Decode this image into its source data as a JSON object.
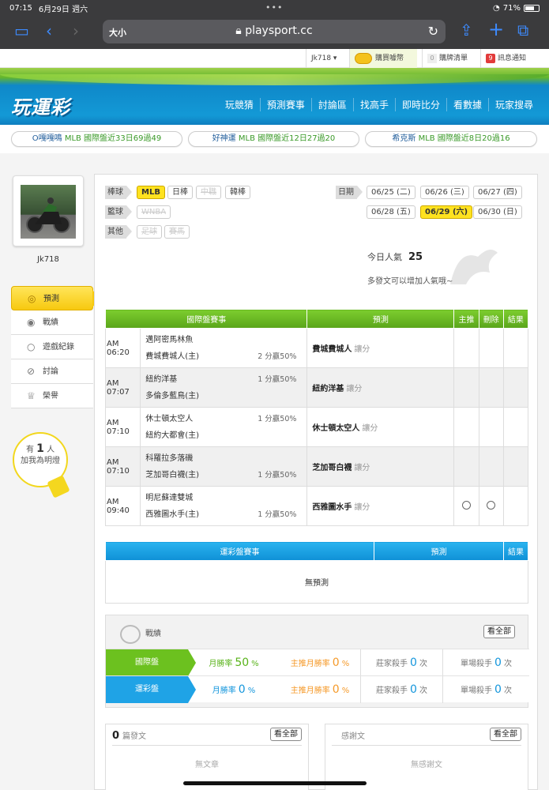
{
  "statusbar": {
    "time": "07:15",
    "date": "6月29日 週六",
    "battery": "71%"
  },
  "browser": {
    "text_size": "大小",
    "url": "playsport.cc"
  },
  "util": {
    "user": "Jk718 ▾",
    "buy": "購買噱幣",
    "cart_count": "0",
    "cart": "購牌清單",
    "notify_count": "9",
    "notify": "訊息通知"
  },
  "header": {
    "logo": "玩運彩",
    "nav": [
      "玩競猜",
      "預測賽事",
      "討論區",
      "找高手",
      "即時比分",
      "看數據",
      "玩家搜尋"
    ]
  },
  "tickers": [
    {
      "name": "O嘎嘎鳴",
      "text": "MLB 國際盤近33日69過49"
    },
    {
      "name": "好神運",
      "text": "MLB 國際盤近12日27過20"
    },
    {
      "name": "希克斯",
      "text": "MLB 國際盤近8日20過16"
    }
  ],
  "profile": {
    "username": "Jk718",
    "menu": [
      "預測",
      "戰績",
      "遊戲紀錄",
      "討論",
      "榮譽"
    ],
    "fans_prefix": "有",
    "fans_count": "1",
    "fans_unit": "人",
    "fans_suffix": "加我為明燈"
  },
  "filters": {
    "baseball_label": "棒球",
    "baseball": [
      "MLB",
      "日棒",
      "中職",
      "韓棒"
    ],
    "basketball_label": "籃球",
    "basketball": [
      "WNBA"
    ],
    "other_label": "其他",
    "other": [
      "足球",
      "賽馬"
    ],
    "date_label": "日期",
    "dates": [
      "06/25 (二)",
      "06/26 (三)",
      "06/27 (四)",
      "06/28 (五)",
      "06/29 (六)",
      "06/30 (日)"
    ]
  },
  "popularity": {
    "label": "今日人氣",
    "value": "25",
    "note": "多發文可以增加人氣哦~"
  },
  "intl_table": {
    "headers": [
      "國際盤賽事",
      "預測",
      "主推",
      "刪除",
      "結果"
    ],
    "rows": [
      {
        "time": "AM 06:20",
        "team1": "邁阿密馬林魚",
        "team2": "費城費城人(主)",
        "odds": "2 分贏50%",
        "odds_row": 2,
        "pick": "費城費城人",
        "type": "讓分",
        "circles": false
      },
      {
        "time": "AM 07:07",
        "team1": "紐約洋基",
        "team2": "多倫多藍鳥(主)",
        "odds": "1 分贏50%",
        "odds_row": 1,
        "pick": "紐約洋基",
        "type": "讓分",
        "circles": false
      },
      {
        "time": "AM 07:10",
        "team1": "休士頓太空人",
        "team2": "紐約大都會(主)",
        "odds": "1 分贏50%",
        "odds_row": 1,
        "pick": "休士頓太空人",
        "type": "讓分",
        "circles": false
      },
      {
        "time": "AM 07:10",
        "team1": "科羅拉多落磯",
        "team2": "芝加哥白襪(主)",
        "odds": "1 分贏50%",
        "odds_row": 2,
        "pick": "芝加哥白襪",
        "type": "讓分",
        "circles": false
      },
      {
        "time": "AM 09:40",
        "team1": "明尼蘇達雙城",
        "team2": "西雅圖水手(主)",
        "odds": "1 分贏50%",
        "odds_row": 2,
        "pick": "西雅圖水手",
        "type": "讓分",
        "circles": true
      }
    ]
  },
  "lottery_table": {
    "headers": [
      "運彩盤賽事",
      "預測",
      "結果"
    ],
    "empty": "無預測"
  },
  "record": {
    "title": "戰績",
    "view_all": "看全部",
    "rows": [
      {
        "label": "國際盤",
        "month_label": "月勝率",
        "month_value": "50",
        "top_label": "主推月勝率",
        "top_value": "0",
        "banker_label": "莊家殺手",
        "banker_value": "0",
        "single_label": "單場殺手",
        "single_value": "0"
      },
      {
        "label": "運彩盤",
        "month_label": "月勝率",
        "month_value": "0",
        "top_label": "主推月勝率",
        "top_value": "0",
        "banker_label": "莊家殺手",
        "banker_value": "0",
        "single_label": "單場殺手",
        "single_value": "0"
      }
    ],
    "pct": "%",
    "times": "次"
  },
  "posts": {
    "count": "0",
    "label": "篇發文",
    "view_all": "看全部",
    "empty": "無文章"
  },
  "thanks": {
    "label": "感謝文",
    "view_all": "看全部",
    "empty": "無感謝文"
  },
  "colors": {
    "green": "#6cc11f",
    "blue": "#1fa3e6",
    "yellow": "#ffe21f",
    "orange": "#f59a2a"
  }
}
